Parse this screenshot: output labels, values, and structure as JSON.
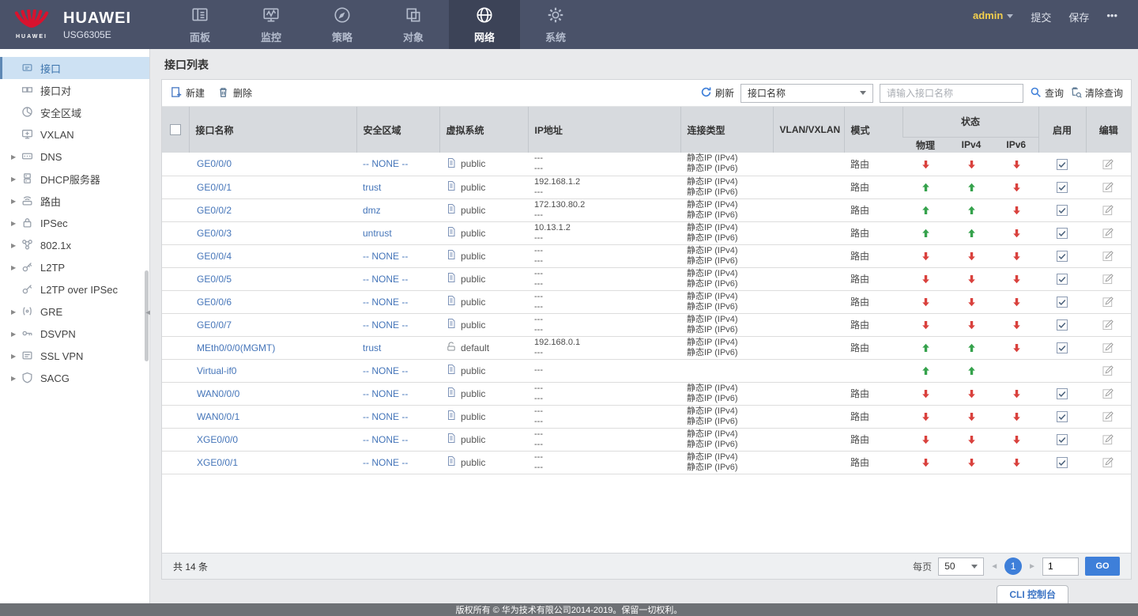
{
  "header": {
    "brand": "HUAWEI",
    "model": "USG6305E",
    "logo_text": "HUAWEI",
    "tabs": [
      {
        "key": "dashboard",
        "label": "面板",
        "icon": "dashboard-icon",
        "active": false
      },
      {
        "key": "monitor",
        "label": "监控",
        "icon": "monitor-icon",
        "active": false
      },
      {
        "key": "policy",
        "label": "策略",
        "icon": "policy-icon",
        "active": false
      },
      {
        "key": "object",
        "label": "对象",
        "icon": "object-icon",
        "active": false
      },
      {
        "key": "network",
        "label": "网络",
        "icon": "network-icon",
        "active": true
      },
      {
        "key": "system",
        "label": "系统",
        "icon": "system-icon",
        "active": false
      }
    ],
    "user": "admin",
    "submit_label": "提交",
    "save_label": "保存",
    "more_label": "•••"
  },
  "sidebar": {
    "items": [
      {
        "key": "interface",
        "label": "接口",
        "icon": "interface-icon",
        "selected": true,
        "expandable": false
      },
      {
        "key": "interface-pair",
        "label": "接口对",
        "icon": "interface-pair-icon",
        "selected": false,
        "expandable": false
      },
      {
        "key": "security-zone",
        "label": "安全区域",
        "icon": "zone-icon",
        "selected": false,
        "expandable": false
      },
      {
        "key": "vxlan",
        "label": "VXLAN",
        "icon": "vxlan-icon",
        "selected": false,
        "expandable": false
      },
      {
        "key": "dns",
        "label": "DNS",
        "icon": "dns-icon",
        "selected": false,
        "expandable": true
      },
      {
        "key": "dhcp-server",
        "label": "DHCP服务器",
        "icon": "dhcp-icon",
        "selected": false,
        "expandable": true
      },
      {
        "key": "route",
        "label": "路由",
        "icon": "route-icon",
        "selected": false,
        "expandable": true
      },
      {
        "key": "ipsec",
        "label": "IPSec",
        "icon": "ipsec-icon",
        "selected": false,
        "expandable": true
      },
      {
        "key": "dot1x",
        "label": "802.1x",
        "icon": "dot1x-icon",
        "selected": false,
        "expandable": true
      },
      {
        "key": "l2tp",
        "label": "L2TP",
        "icon": "l2tp-icon",
        "selected": false,
        "expandable": true
      },
      {
        "key": "l2tp-over-ipsec",
        "label": "L2TP over IPSec",
        "icon": "l2tp-ipsec-icon",
        "selected": false,
        "expandable": false
      },
      {
        "key": "gre",
        "label": "GRE",
        "icon": "gre-icon",
        "selected": false,
        "expandable": true
      },
      {
        "key": "dsvpn",
        "label": "DSVPN",
        "icon": "dsvpn-icon",
        "selected": false,
        "expandable": true
      },
      {
        "key": "ssl-vpn",
        "label": "SSL VPN",
        "icon": "sslvpn-icon",
        "selected": false,
        "expandable": true
      },
      {
        "key": "sacg",
        "label": "SACG",
        "icon": "sacg-icon",
        "selected": false,
        "expandable": true
      }
    ]
  },
  "main": {
    "title": "接口列表",
    "toolbar": {
      "new_label": "新建",
      "delete_label": "删除",
      "refresh_label": "刷新",
      "filter_value": "接口名称",
      "search_placeholder": "请输入接口名称",
      "query_label": "查询",
      "clear_label": "清除查询"
    },
    "table": {
      "columns": {
        "name": "接口名称",
        "zone": "安全区域",
        "vsys": "虚拟系统",
        "ip": "IP地址",
        "conn": "连接类型",
        "vlan": "VLAN/VXLAN",
        "mode": "模式",
        "status": "状态",
        "phys": "物理",
        "ipv4": "IPv4",
        "ipv6": "IPv6",
        "enable": "启用",
        "edit": "编辑"
      },
      "rows": [
        {
          "name": "GE0/0/0",
          "zone": "-- NONE --",
          "vsys": "public",
          "vsys_icon": "vsys-public-icon",
          "ip": [
            "---",
            "---"
          ],
          "conn": [
            "静态IP (IPv4)",
            "静态IP (IPv6)"
          ],
          "vlan": "",
          "mode": "路由",
          "status": {
            "phys": "down",
            "ipv4": "down",
            "ipv6": "down"
          },
          "enabled": true,
          "edit": true
        },
        {
          "name": "GE0/0/1",
          "zone": "trust",
          "vsys": "public",
          "vsys_icon": "vsys-public-icon",
          "ip": [
            "192.168.1.2",
            "---"
          ],
          "conn": [
            "静态IP (IPv4)",
            "静态IP (IPv6)"
          ],
          "vlan": "",
          "mode": "路由",
          "status": {
            "phys": "up",
            "ipv4": "up",
            "ipv6": "down"
          },
          "enabled": true,
          "edit": true
        },
        {
          "name": "GE0/0/2",
          "zone": "dmz",
          "vsys": "public",
          "vsys_icon": "vsys-public-icon",
          "ip": [
            "172.130.80.2",
            "---"
          ],
          "conn": [
            "静态IP (IPv4)",
            "静态IP (IPv6)"
          ],
          "vlan": "",
          "mode": "路由",
          "status": {
            "phys": "up",
            "ipv4": "up",
            "ipv6": "down"
          },
          "enabled": true,
          "edit": true
        },
        {
          "name": "GE0/0/3",
          "zone": "untrust",
          "vsys": "public",
          "vsys_icon": "vsys-public-icon",
          "ip": [
            "10.13.1.2",
            "---"
          ],
          "conn": [
            "静态IP (IPv4)",
            "静态IP (IPv6)"
          ],
          "vlan": "",
          "mode": "路由",
          "status": {
            "phys": "up",
            "ipv4": "up",
            "ipv6": "down"
          },
          "enabled": true,
          "edit": true
        },
        {
          "name": "GE0/0/4",
          "zone": "-- NONE --",
          "vsys": "public",
          "vsys_icon": "vsys-public-icon",
          "ip": [
            "---",
            "---"
          ],
          "conn": [
            "静态IP (IPv4)",
            "静态IP (IPv6)"
          ],
          "vlan": "",
          "mode": "路由",
          "status": {
            "phys": "down",
            "ipv4": "down",
            "ipv6": "down"
          },
          "enabled": true,
          "edit": true
        },
        {
          "name": "GE0/0/5",
          "zone": "-- NONE --",
          "vsys": "public",
          "vsys_icon": "vsys-public-icon",
          "ip": [
            "---",
            "---"
          ],
          "conn": [
            "静态IP (IPv4)",
            "静态IP (IPv6)"
          ],
          "vlan": "",
          "mode": "路由",
          "status": {
            "phys": "down",
            "ipv4": "down",
            "ipv6": "down"
          },
          "enabled": true,
          "edit": true
        },
        {
          "name": "GE0/0/6",
          "zone": "-- NONE --",
          "vsys": "public",
          "vsys_icon": "vsys-public-icon",
          "ip": [
            "---",
            "---"
          ],
          "conn": [
            "静态IP (IPv4)",
            "静态IP (IPv6)"
          ],
          "vlan": "",
          "mode": "路由",
          "status": {
            "phys": "down",
            "ipv4": "down",
            "ipv6": "down"
          },
          "enabled": true,
          "edit": true
        },
        {
          "name": "GE0/0/7",
          "zone": "-- NONE --",
          "vsys": "public",
          "vsys_icon": "vsys-public-icon",
          "ip": [
            "---",
            "---"
          ],
          "conn": [
            "静态IP (IPv4)",
            "静态IP (IPv6)"
          ],
          "vlan": "",
          "mode": "路由",
          "status": {
            "phys": "down",
            "ipv4": "down",
            "ipv6": "down"
          },
          "enabled": true,
          "edit": true
        },
        {
          "name": "MEth0/0/0(MGMT)",
          "zone": "trust",
          "vsys": "default",
          "vsys_icon": "vsys-default-icon",
          "ip": [
            "192.168.0.1",
            "---"
          ],
          "conn": [
            "静态IP (IPv4)",
            "静态IP (IPv6)"
          ],
          "vlan": "",
          "mode": "路由",
          "status": {
            "phys": "up",
            "ipv4": "up",
            "ipv6": "down"
          },
          "enabled": true,
          "edit": true
        },
        {
          "name": "Virtual-if0",
          "zone": "-- NONE --",
          "vsys": "public",
          "vsys_icon": "vsys-public-icon",
          "ip": [
            "---"
          ],
          "conn": [],
          "vlan": "",
          "mode": "",
          "status": {
            "phys": "up",
            "ipv4": "up",
            "ipv6": ""
          },
          "enabled": false,
          "edit": true
        },
        {
          "name": "WAN0/0/0",
          "zone": "-- NONE --",
          "vsys": "public",
          "vsys_icon": "vsys-public-icon",
          "ip": [
            "---",
            "---"
          ],
          "conn": [
            "静态IP (IPv4)",
            "静态IP (IPv6)"
          ],
          "vlan": "",
          "mode": "路由",
          "status": {
            "phys": "down",
            "ipv4": "down",
            "ipv6": "down"
          },
          "enabled": true,
          "edit": true
        },
        {
          "name": "WAN0/0/1",
          "zone": "-- NONE --",
          "vsys": "public",
          "vsys_icon": "vsys-public-icon",
          "ip": [
            "---",
            "---"
          ],
          "conn": [
            "静态IP (IPv4)",
            "静态IP (IPv6)"
          ],
          "vlan": "",
          "mode": "路由",
          "status": {
            "phys": "down",
            "ipv4": "down",
            "ipv6": "down"
          },
          "enabled": true,
          "edit": true
        },
        {
          "name": "XGE0/0/0",
          "zone": "-- NONE --",
          "vsys": "public",
          "vsys_icon": "vsys-public-icon",
          "ip": [
            "---",
            "---"
          ],
          "conn": [
            "静态IP (IPv4)",
            "静态IP (IPv6)"
          ],
          "vlan": "",
          "mode": "路由",
          "status": {
            "phys": "down",
            "ipv4": "down",
            "ipv6": "down"
          },
          "enabled": true,
          "edit": true
        },
        {
          "name": "XGE0/0/1",
          "zone": "-- NONE --",
          "vsys": "public",
          "vsys_icon": "vsys-public-icon",
          "ip": [
            "---",
            "---"
          ],
          "conn": [
            "静态IP (IPv4)",
            "静态IP (IPv6)"
          ],
          "vlan": "",
          "mode": "路由",
          "status": {
            "phys": "down",
            "ipv4": "down",
            "ipv6": "down"
          },
          "enabled": true,
          "edit": true
        }
      ]
    },
    "pagination": {
      "total": "共 14 条",
      "per_page_label": "每页",
      "per_page": "50",
      "page": "1",
      "goto_value": "1",
      "go_label": "GO"
    },
    "cli_label": "CLI 控制台"
  },
  "footer": {
    "copyright": "版权所有 © 华为技术有限公司2014-2019。保留一切权利。"
  },
  "colors": {
    "nav_bg": "#4a5269",
    "nav_active_bg": "#3c4357",
    "admin_yellow": "#f3cf4d",
    "link_blue": "#4575b9",
    "accent_blue": "#3e7fd9",
    "status_up": "#35a24c",
    "status_down": "#d9413d",
    "selected_item_bg": "#cde1f3",
    "footer_bg": "#6e7175"
  }
}
